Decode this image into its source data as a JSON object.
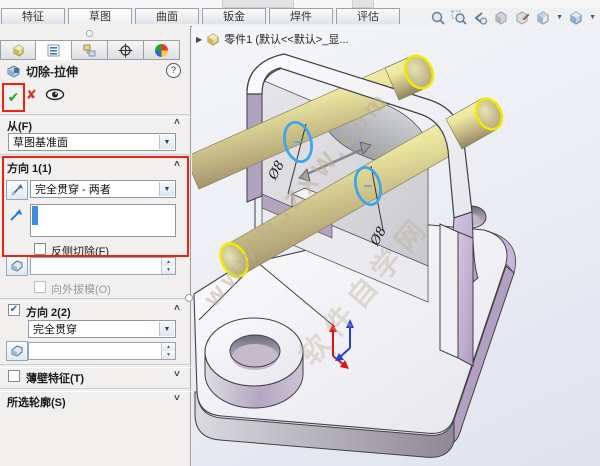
{
  "ribbon": {
    "tabs": [
      "特征",
      "草图",
      "曲面",
      "钣金",
      "焊件",
      "评估"
    ],
    "active_tab": "草图"
  },
  "headsup": {
    "icons": [
      "zoom-fit",
      "zoom-area",
      "previous-view",
      "section-view",
      "edit-appearance",
      "view-orientation",
      "display-style"
    ]
  },
  "pm": {
    "manager_tabs": [
      "feature-manager",
      "property-manager",
      "configuration-manager",
      "dimxpert-manager",
      "display-manager"
    ],
    "active_manager_tab": "property-manager",
    "title": "切除-拉伸",
    "help_label": "?",
    "from": {
      "header": "从(F)",
      "plane": "草图基准面"
    },
    "dir1": {
      "header": "方向 1(1)",
      "end_condition": "完全贯穿 - 两者",
      "selection_value": "",
      "flip_side": "反侧切除(F)",
      "draft_value": "",
      "draft_outward": "向外拔模(O)"
    },
    "dir2": {
      "header": "方向 2(2)",
      "end_condition": "完全贯穿",
      "checked": true,
      "draft_value": ""
    },
    "thin": {
      "header": "薄壁特征(T)",
      "checked": false
    },
    "contours": {
      "header": "所选轮廓(S)"
    }
  },
  "viewport": {
    "feature_tree_label": "零件1 (默认<<默认>_显...",
    "dimension_labels": {
      "d1": "Ø8",
      "d2": "Ø8"
    },
    "watermark_line1": "www.RJZXW.com",
    "watermark_line2": "软件自学网"
  },
  "icons": {
    "chevron_up": "˄",
    "chevron_down": "˅",
    "dropdown": "▼",
    "flyout": "▶",
    "confirm": "✔",
    "cancel": "✘",
    "check": "✔",
    "spin_up": "▲",
    "spin_down": "▼",
    "help": "?"
  },
  "colors": {
    "annotation_red": "#ee2211",
    "selection_blue": "#3e8ddd",
    "confirm_green": "#1fa51f",
    "cancel_red": "#d93025",
    "highlight_yellow": "#f0ec00",
    "circle_blue": "#3fa5e8",
    "rod_yellow": "#ece8a4",
    "lavender": "#c3b2d2"
  }
}
